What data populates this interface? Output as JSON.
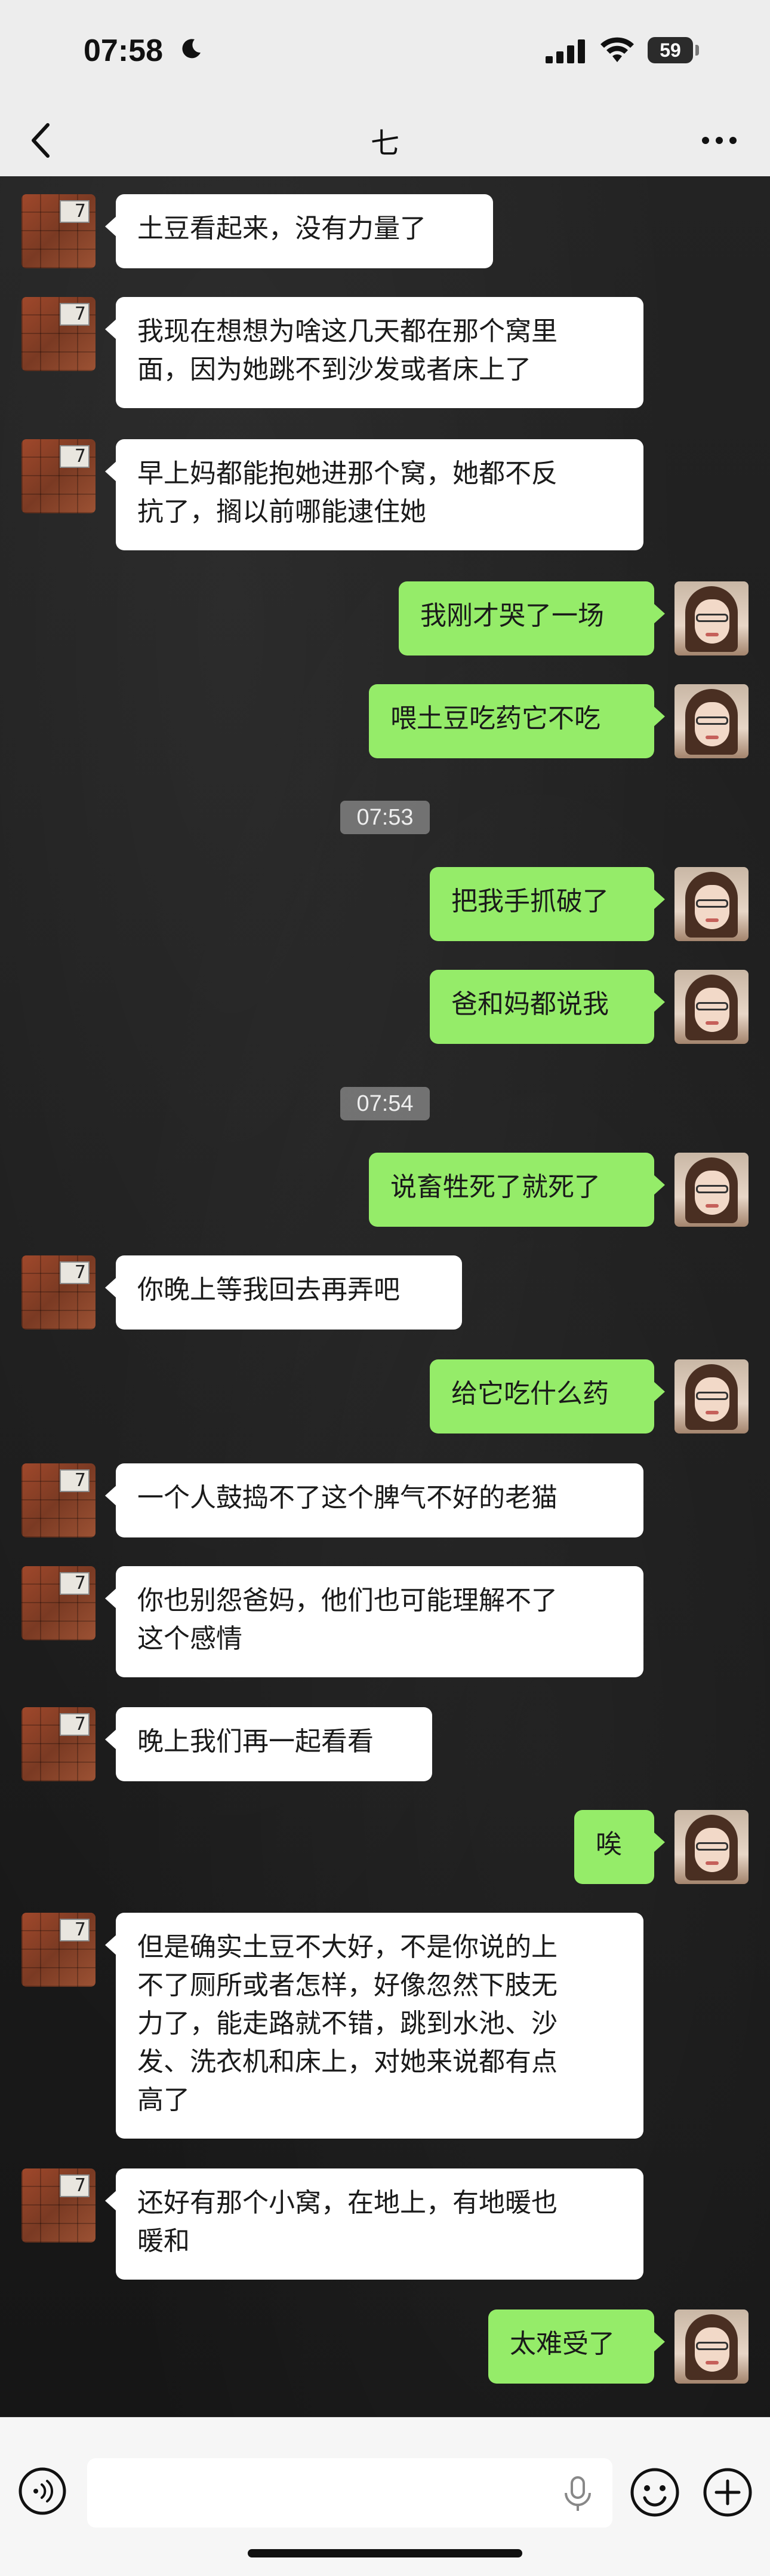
{
  "status_bar": {
    "time": "07:58",
    "battery": "59"
  },
  "nav": {
    "title": "七"
  },
  "messages": [
    {
      "side": "left",
      "lines": [
        "土豆看起来，没有力量了"
      ]
    },
    {
      "side": "left",
      "lines": [
        "我现在想想为啥这几天都在那个窝里",
        "面，因为她跳不到沙发或者床上了"
      ]
    },
    {
      "side": "left",
      "lines": [
        "早上妈都能抱她进那个窝，她都不反",
        "抗了，搁以前哪能逮住她"
      ]
    },
    {
      "side": "right",
      "lines": [
        "我刚才哭了一场"
      ]
    },
    {
      "side": "right",
      "lines": [
        "喂土豆吃药它不吃"
      ]
    },
    {
      "side": "time",
      "lines": [
        "07:53"
      ]
    },
    {
      "side": "right",
      "lines": [
        "把我手抓破了"
      ]
    },
    {
      "side": "right",
      "lines": [
        "爸和妈都说我"
      ]
    },
    {
      "side": "time",
      "lines": [
        "07:54"
      ]
    },
    {
      "side": "right",
      "lines": [
        "说畜牲死了就死了"
      ]
    },
    {
      "side": "left",
      "lines": [
        "你晚上等我回去再弄吧"
      ]
    },
    {
      "side": "right",
      "lines": [
        "给它吃什么药"
      ]
    },
    {
      "side": "left",
      "lines": [
        "一个人鼓捣不了这个脾气不好的老猫"
      ]
    },
    {
      "side": "left",
      "lines": [
        "你也别怨爸妈，他们也可能理解不了",
        "这个感情"
      ]
    },
    {
      "side": "left",
      "lines": [
        "晚上我们再一起看看"
      ]
    },
    {
      "side": "right",
      "lines": [
        "唉"
      ]
    },
    {
      "side": "left",
      "lines": [
        "但是确实土豆不大好，不是你说的上",
        "不了厕所或者怎样，好像忽然下肢无",
        "力了，能走路就不错，跳到水池、沙",
        "发、洗衣机和床上，对她来说都有点",
        "高了"
      ]
    },
    {
      "side": "left",
      "lines": [
        "还好有那个小窝，在地上，有地暖也",
        "暖和"
      ]
    },
    {
      "side": "right",
      "lines": [
        "太难受了"
      ]
    }
  ],
  "avatar_left_sign": "7",
  "icons": [
    "moon-icon",
    "signal-icon",
    "wifi-icon",
    "back-icon",
    "more-icon",
    "voice-icon",
    "mic-icon",
    "emoji-icon",
    "plus-icon"
  ]
}
